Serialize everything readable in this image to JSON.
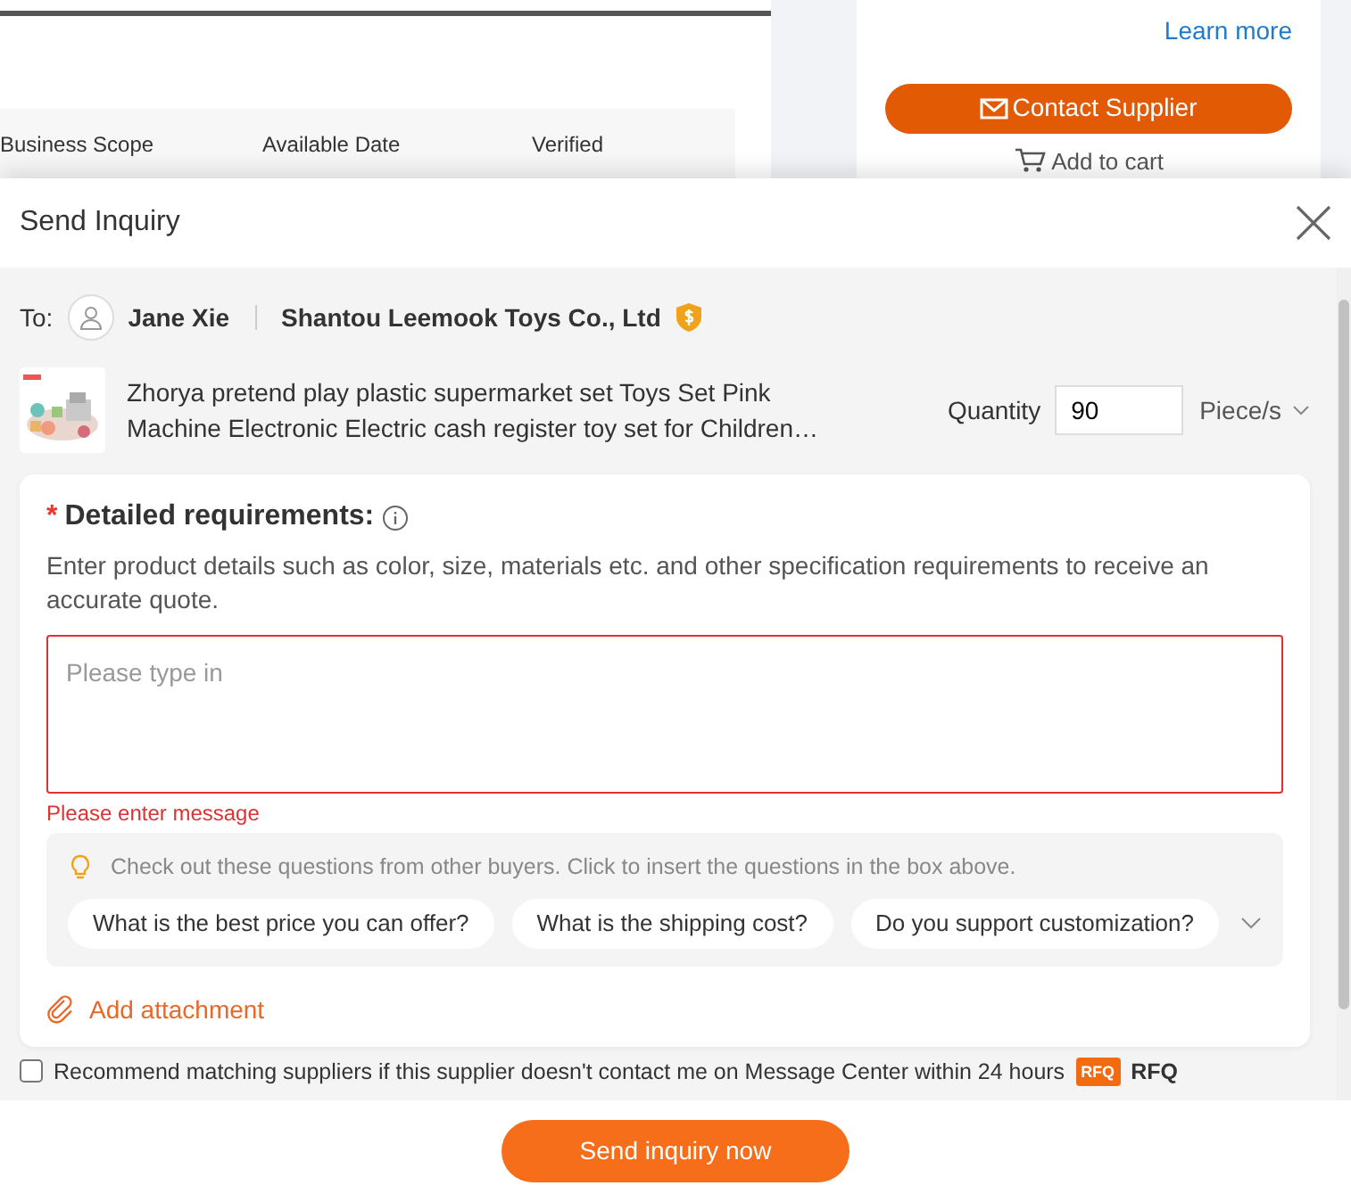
{
  "background": {
    "table_columns": [
      "Business Scope",
      "Available Date",
      "Verified"
    ],
    "learn_more": "Learn more",
    "contact_button": "Contact Supplier",
    "add_to_cart": "Add to cart"
  },
  "dialog": {
    "title": "Send Inquiry",
    "to_label": "To:",
    "contact_name": "Jane Xie",
    "company": "Shantou Leemook Toys Co., Ltd",
    "product": {
      "name": "Zhorya pretend play plastic supermarket set Toys Set Pink Machine Electronic Electric cash register toy set for Children…",
      "quantity_label": "Quantity",
      "quantity": "90",
      "unit": "Piece/s"
    },
    "requirements": {
      "required": true,
      "required_mark": "*",
      "label": "Detailed requirements:",
      "hint": "Enter product details such as color, size, materials etc. and other specification requirements to receive an accurate quote.",
      "placeholder": "Please type in",
      "error": "Please enter message"
    },
    "suggestions": {
      "hint": "Check out these questions from other buyers. Click to insert the questions in the box above.",
      "questions": [
        "What is the best price you can offer?",
        "What is the shipping cost?",
        "Do you support customization?"
      ]
    },
    "attachment": "Add attachment",
    "recommend": {
      "checked": false,
      "text": "Recommend matching suppliers if this supplier doesn't contact me on Message Center within 24 hours",
      "badge": "RFQ",
      "label": "RFQ"
    },
    "submit": "Send inquiry now"
  }
}
